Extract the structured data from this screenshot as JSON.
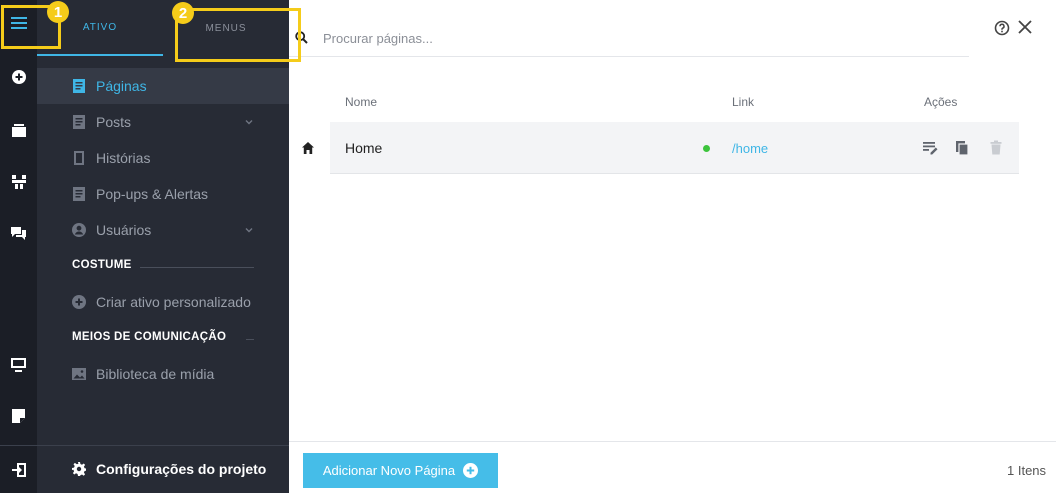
{
  "tabs": {
    "ativo": "ATIVO",
    "menus": "MENUS"
  },
  "nav": {
    "items": [
      {
        "label": "Páginas",
        "icon": "page-icon",
        "active": true
      },
      {
        "label": "Posts",
        "icon": "posts-icon",
        "expandable": true
      },
      {
        "label": "Histórias",
        "icon": "stories-icon"
      },
      {
        "label": "Pop-ups & Alertas",
        "icon": "popups-icon"
      },
      {
        "label": "Usuários",
        "icon": "user-icon",
        "expandable": true
      }
    ],
    "sections": {
      "custom": "COSTUME",
      "media": "MEIOS DE COMUNICAÇÃO"
    },
    "custom_action": "Criar ativo personalizado",
    "media_library": "Biblioteca de mídia",
    "settings": "Configurações do projeto"
  },
  "callouts": {
    "one": "1",
    "two": "2"
  },
  "search": {
    "placeholder": "Procurar páginas..."
  },
  "table": {
    "headers": {
      "name": "Nome",
      "link": "Link",
      "actions": "Ações"
    },
    "rows": [
      {
        "name": "Home",
        "link": "/home",
        "status": "published"
      }
    ]
  },
  "footer": {
    "add_button": "Adicionar Novo Página",
    "count": "1 Itens"
  },
  "colors": {
    "accent": "#3fb6e6",
    "callout": "#f5cc1a",
    "status_ok": "#3cc43c",
    "panel": "#272b35",
    "rail": "#1b1e26"
  }
}
